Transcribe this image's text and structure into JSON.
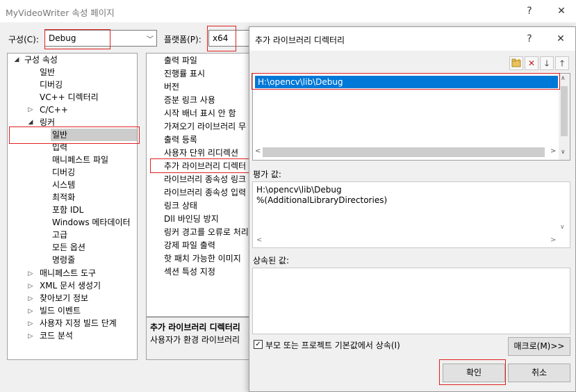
{
  "window": {
    "title": "MyVideoWriter 속성 페이지",
    "help": "?",
    "close": "✕"
  },
  "config": {
    "label": "구성(C):",
    "value": "Debug",
    "platform_label": "플랫폼(P):",
    "platform_value": "x64"
  },
  "tree": {
    "root": "구성 속성",
    "general": "일반",
    "debugging": "디버깅",
    "vcpp_dirs": "VC++ 디렉터리",
    "cpp": "C/C++",
    "linker": "링커",
    "linker_children": [
      "일반",
      "입력",
      "매니페스트 파일",
      "디버깅",
      "시스템",
      "최적화",
      "포함 IDL",
      "Windows 메타데이터",
      "고급",
      "모든 옵션",
      "명령줄"
    ],
    "after": [
      "매니페스트 도구",
      "XML 문서 생성기",
      "찾아보기 정보",
      "빌드 이벤트",
      "사용자 지정 빌드 단계",
      "코드 분석"
    ]
  },
  "properties": [
    "출력 파일",
    "진행률 표시",
    "버전",
    "증분 링크 사용",
    "시작 배너 표시 안 함",
    "가져오기 라이브러리 무",
    "출력 등록",
    "사용자 단위 리디렉션",
    "추가 라이브러리 디렉터",
    "라이브러리 종속성 링크",
    "라이브러리 종속성 입력",
    "링크 상태",
    "Dll 바인딩 방지",
    "링커 경고를 오류로 처리",
    "강제 파일 출력",
    "핫 패치 가능한 이미지",
    "섹션 특성 지정"
  ],
  "description": {
    "title": "추가 라이브러리 디렉터리",
    "text": "사용자가 환경 라이브러리"
  },
  "dialog": {
    "title": "추가 라이브러리 디렉터리",
    "help": "?",
    "close": "✕",
    "entries": [
      "H:\\opencv\\lib\\Debug"
    ],
    "evaluated_label": "평가 값:",
    "evaluated_lines": [
      "H:\\opencv\\lib\\Debug",
      "%(AdditionalLibraryDirectories)"
    ],
    "inherited_label": "상속된 값:",
    "inherit_checkbox": "부모 또는 프로젝트 기본값에서 상속(I)",
    "inherit_checked": true,
    "macro_button": "매크로(M)>>",
    "ok_button": "확인",
    "cancel_button": "취소"
  },
  "colors": {
    "selection": "#0078d7",
    "highlight_box": "#e02020"
  }
}
